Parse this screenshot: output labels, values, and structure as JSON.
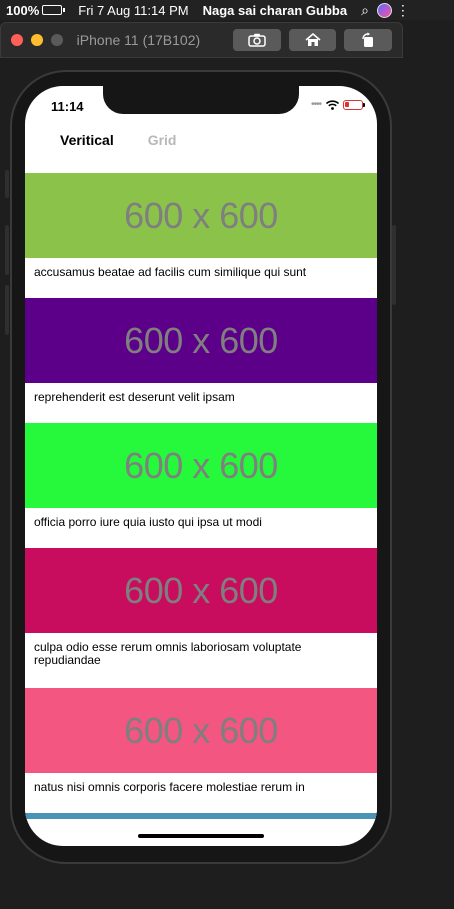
{
  "menubar": {
    "battery_pct": "100%",
    "datetime": "Fri 7 Aug  11:14 PM",
    "user": "Naga sai charan Gubba"
  },
  "simulator": {
    "title": "iPhone 11 (17B102)"
  },
  "statusbar": {
    "time": "11:14"
  },
  "tabs": [
    {
      "label": "Veritical",
      "active": true
    },
    {
      "label": "Grid",
      "active": false
    }
  ],
  "feed": [
    {
      "image_text": "600 x 600",
      "color": "#8bc34a",
      "caption": "accusamus beatae ad facilis cum similique qui sunt"
    },
    {
      "image_text": "600 x 600",
      "color": "#5c0089",
      "caption": "reprehenderit est deserunt velit ipsam"
    },
    {
      "image_text": "600 x 600",
      "color": "#26f83c",
      "caption": "officia porro iure quia iusto qui ipsa ut modi"
    },
    {
      "image_text": "600 x 600",
      "color": "#c80c5e",
      "caption": "culpa odio esse rerum omnis laboriosam voluptate repudiandae"
    },
    {
      "image_text": "600 x 600",
      "color": "#f25681",
      "caption": "natus nisi omnis corporis facere molestiae rerum in"
    }
  ],
  "peek_color": "#4a95b5"
}
